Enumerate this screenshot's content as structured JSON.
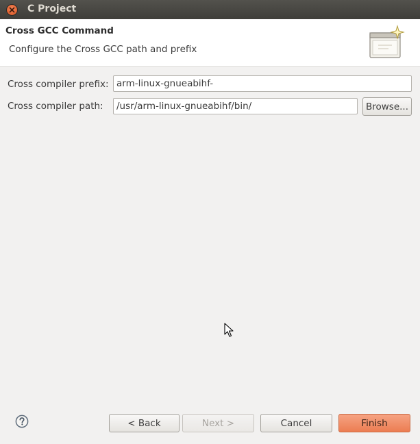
{
  "window": {
    "title": "C Project"
  },
  "header": {
    "title": "Cross GCC Command",
    "description": "Configure the Cross GCC path and prefix",
    "icon": "wizard-banner-icon"
  },
  "form": {
    "prefix_label": "Cross compiler prefix:",
    "prefix_value": "arm-linux-gnueabihf-",
    "path_label": "Cross compiler path:",
    "path_value": "/usr/arm-linux-gnueabihf/bin/",
    "browse_label": "Browse..."
  },
  "footer": {
    "help_icon": "help-icon",
    "back_label": "< Back",
    "next_label": "Next >",
    "cancel_label": "Cancel",
    "finish_label": "Finish"
  },
  "colors": {
    "titlebar": "#3e3d39",
    "close_button": "#e2612c",
    "finish_button": "#ec7d52",
    "background": "#f2f1f0"
  }
}
